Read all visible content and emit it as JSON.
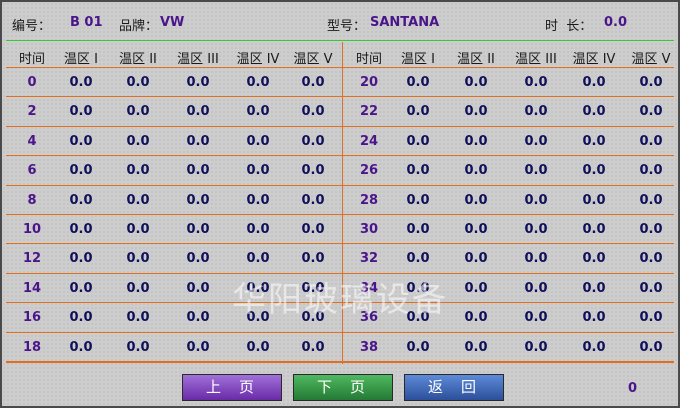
{
  "header": {
    "code_label": "编号：",
    "code_value": "B 01",
    "brand_label": "品牌：",
    "brand_value": "VW",
    "model_label": "型号：",
    "model_value": "SANTANA",
    "duration_label": "时  长：",
    "duration_value": "0.0"
  },
  "columns": [
    "时间",
    "温区 I",
    "温区 II",
    "温区 III",
    "温区 IV",
    "温区 V"
  ],
  "left_rows": [
    {
      "time": "0",
      "v": [
        "0.0",
        "0.0",
        "0.0",
        "0.0",
        "0.0"
      ]
    },
    {
      "time": "2",
      "v": [
        "0.0",
        "0.0",
        "0.0",
        "0.0",
        "0.0"
      ]
    },
    {
      "time": "4",
      "v": [
        "0.0",
        "0.0",
        "0.0",
        "0.0",
        "0.0"
      ]
    },
    {
      "time": "6",
      "v": [
        "0.0",
        "0.0",
        "0.0",
        "0.0",
        "0.0"
      ]
    },
    {
      "time": "8",
      "v": [
        "0.0",
        "0.0",
        "0.0",
        "0.0",
        "0.0"
      ]
    },
    {
      "time": "10",
      "v": [
        "0.0",
        "0.0",
        "0.0",
        "0.0",
        "0.0"
      ]
    },
    {
      "time": "12",
      "v": [
        "0.0",
        "0.0",
        "0.0",
        "0.0",
        "0.0"
      ]
    },
    {
      "time": "14",
      "v": [
        "0.0",
        "0.0",
        "0.0",
        "0.0",
        "0.0"
      ]
    },
    {
      "time": "16",
      "v": [
        "0.0",
        "0.0",
        "0.0",
        "0.0",
        "0.0"
      ]
    },
    {
      "time": "18",
      "v": [
        "0.0",
        "0.0",
        "0.0",
        "0.0",
        "0.0"
      ]
    }
  ],
  "right_rows": [
    {
      "time": "20",
      "v": [
        "0.0",
        "0.0",
        "0.0",
        "0.0",
        "0.0"
      ]
    },
    {
      "time": "22",
      "v": [
        "0.0",
        "0.0",
        "0.0",
        "0.0",
        "0.0"
      ]
    },
    {
      "time": "24",
      "v": [
        "0.0",
        "0.0",
        "0.0",
        "0.0",
        "0.0"
      ]
    },
    {
      "time": "26",
      "v": [
        "0.0",
        "0.0",
        "0.0",
        "0.0",
        "0.0"
      ]
    },
    {
      "time": "28",
      "v": [
        "0.0",
        "0.0",
        "0.0",
        "0.0",
        "0.0"
      ]
    },
    {
      "time": "30",
      "v": [
        "0.0",
        "0.0",
        "0.0",
        "0.0",
        "0.0"
      ]
    },
    {
      "time": "32",
      "v": [
        "0.0",
        "0.0",
        "0.0",
        "0.0",
        "0.0"
      ]
    },
    {
      "time": "34",
      "v": [
        "0.0",
        "0.0",
        "0.0",
        "0.0",
        "0.0"
      ]
    },
    {
      "time": "36",
      "v": [
        "0.0",
        "0.0",
        "0.0",
        "0.0",
        "0.0"
      ]
    },
    {
      "time": "38",
      "v": [
        "0.0",
        "0.0",
        "0.0",
        "0.0",
        "0.0"
      ]
    }
  ],
  "buttons": {
    "prev": "上页",
    "next": "下页",
    "back": "返回"
  },
  "page_number": "0",
  "watermark": "华阳玻璃设备",
  "colors": {
    "value_text": "#10105a",
    "label_accent": "#4a158a",
    "grid_line": "#e07020",
    "header_line": "#33cc33",
    "prev_button": "#7f44c0",
    "next_button": "#2f9444",
    "back_button": "#3b63b8"
  }
}
